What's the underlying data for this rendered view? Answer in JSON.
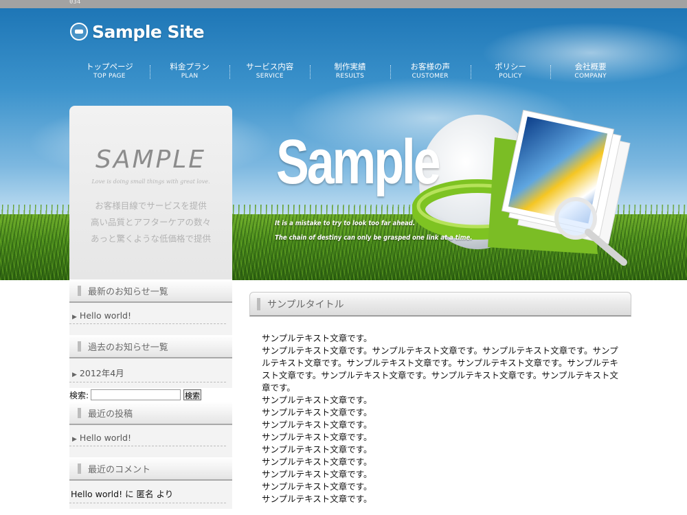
{
  "topbar": {
    "code": "034"
  },
  "site": {
    "logo_text": "Sample Site"
  },
  "nav": [
    {
      "jp": "トップページ",
      "en": "TOP PAGE"
    },
    {
      "jp": "料金プラン",
      "en": "PLAN"
    },
    {
      "jp": "サービス内容",
      "en": "SERVICE"
    },
    {
      "jp": "制作実績",
      "en": "RESULTS"
    },
    {
      "jp": "お客様の声",
      "en": "CUSTOMER"
    },
    {
      "jp": "ポリシー",
      "en": "POLICY"
    },
    {
      "jp": "会社概要",
      "en": "COMPANY"
    }
  ],
  "side_banner": {
    "title": "SAMPLE",
    "tagline": "Love is doing small things with great love.",
    "lines": [
      "お客様目線でサービスを提供",
      "高い品質とアフターケアの数々",
      "あっと驚くような低価格で提供"
    ]
  },
  "hero": {
    "title": "Sample",
    "sub1": "It is a mistake to try to look too far ahead.",
    "sub2": "The chain of destiny can only be grasped one link at a time."
  },
  "sidebar": {
    "news_title": "最新のお知らせ一覧",
    "news_items": [
      "Hello world!"
    ],
    "archive_title": "過去のお知らせ一覧",
    "archive_items": [
      "2012年4月"
    ],
    "search_label": "検索:",
    "search_value": "",
    "search_button": "検索",
    "recent_title": "最近の投稿",
    "recent_items": [
      "Hello world!"
    ],
    "comments_title": "最近のコメント",
    "comment_post": "Hello world!",
    "comment_sep": " に ",
    "comment_author": "匿名",
    "comment_suffix": " より"
  },
  "main": {
    "heading": "サンプルタイトル",
    "paragraphs": [
      "サンプルテキスト文章です。",
      "サンプルテキスト文章です。サンプルテキスト文章です。サンプルテキスト文章です。サンプルテキスト文章です。サンプルテキスト文章です。サンプルテキスト文章です。サンプルテキスト文章です。サンプルテキスト文章です。サンプルテキスト文章です。サンプルテキスト文章です。",
      "サンプルテキスト文章です。",
      "サンプルテキスト文章です。",
      "サンプルテキスト文章です。",
      "サンプルテキスト文章です。",
      "サンプルテキスト文章です。",
      "サンプルテキスト文章です。",
      "サンプルテキスト文章です。",
      "サンプルテキスト文章です。",
      "サンプルテキスト文章です。"
    ]
  }
}
